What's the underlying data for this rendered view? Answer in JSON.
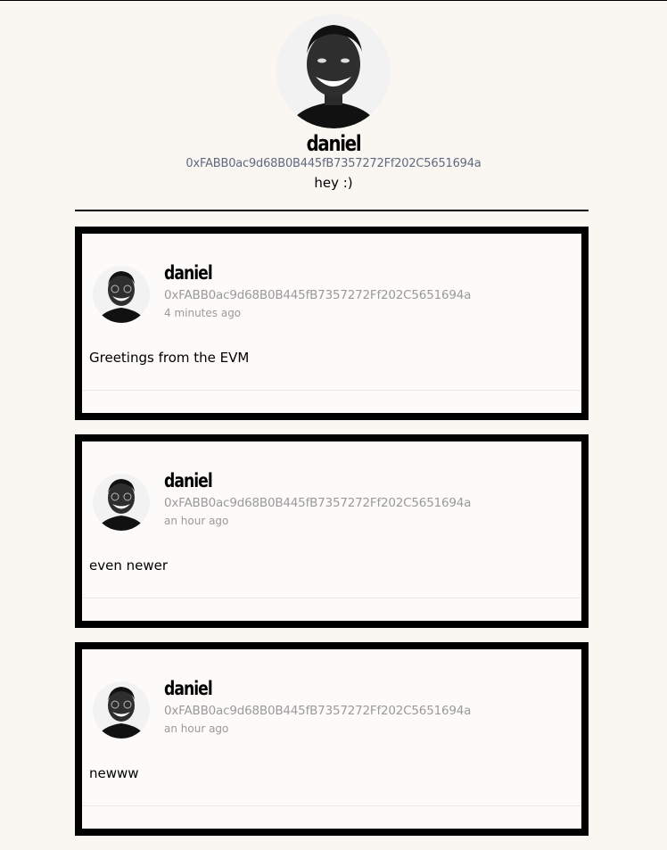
{
  "profile": {
    "name": "daniel",
    "address": "0xFABB0ac9d68B0B445fB7357272Ff202C5651694a",
    "bio": "hey :)",
    "avatar_icon": "avatar-photo-icon"
  },
  "posts": [
    {
      "author": "daniel",
      "address": "0xFABB0ac9d68B0B445fB7357272Ff202C5651694a",
      "time": "4 minutes ago",
      "body": "Greetings from the EVM"
    },
    {
      "author": "daniel",
      "address": "0xFABB0ac9d68B0B445fB7357272Ff202C5651694a",
      "time": "an hour ago",
      "body": "even newer"
    },
    {
      "author": "daniel",
      "address": "0xFABB0ac9d68B0B445fB7357272Ff202C5651694a",
      "time": "an hour ago",
      "body": "newww"
    }
  ],
  "colors": {
    "background": "#faf6f2",
    "address": "#5f6a80",
    "muted": "#9a9a9a",
    "border": "#000000"
  }
}
